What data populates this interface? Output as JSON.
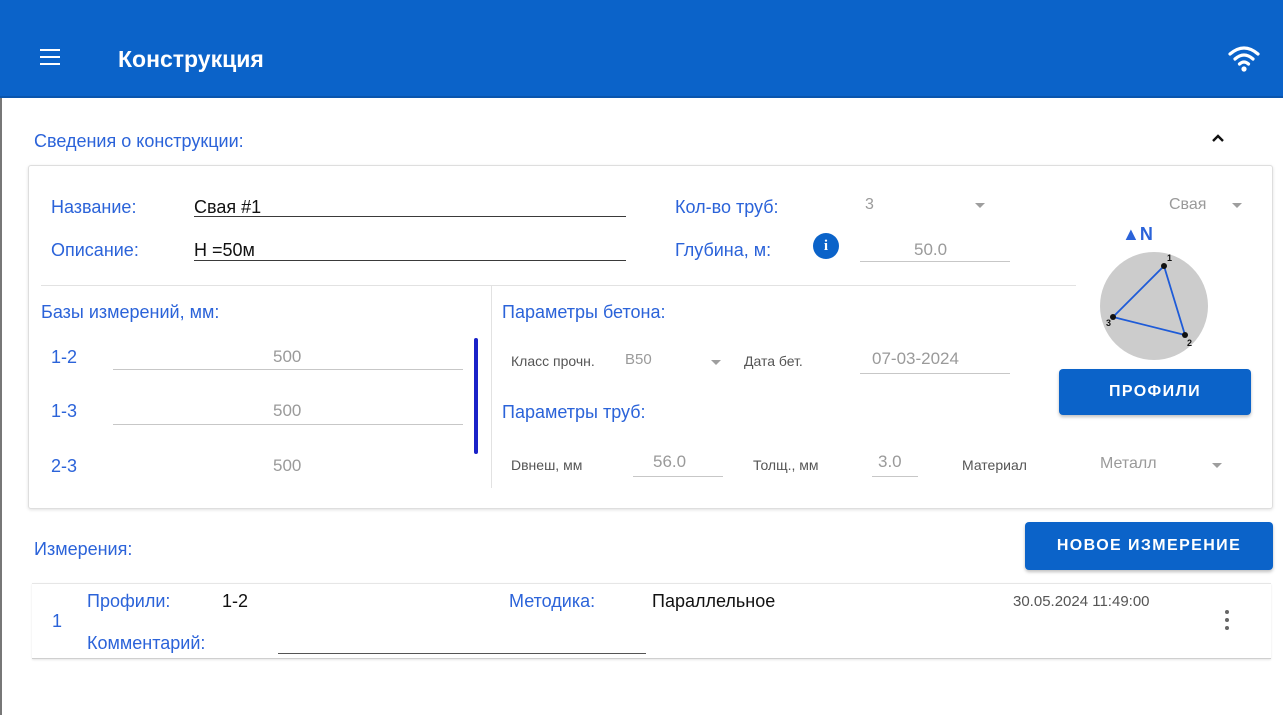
{
  "header": {
    "title": "Конструкция"
  },
  "section": {
    "title": "Сведения о конструкции:"
  },
  "construction": {
    "name_label": "Название:",
    "name_value": "Свая #1",
    "desc_label": "Описание:",
    "desc_value": "H =50м",
    "pipes_label": "Кол-во труб:",
    "pipes_value": "3",
    "depth_label": "Глубина, м:",
    "depth_value": "50.0",
    "type_value": "Свая",
    "north_label": "▲N"
  },
  "bases": {
    "title": "Базы измерений, мм:",
    "rows": [
      {
        "label": "1-2",
        "value": "500"
      },
      {
        "label": "1-3",
        "value": "500"
      },
      {
        "label": "2-3",
        "value": "500"
      }
    ]
  },
  "concrete": {
    "title": "Параметры бетона:",
    "class_label": "Класс прочн.",
    "class_value": "B50",
    "date_label": "Дата бет.",
    "date_value": "07-03-2024"
  },
  "pipes": {
    "title": "Параметры труб:",
    "dout_label": "Dвнеш, мм",
    "dout_value": "56.0",
    "thick_label": "Толщ., мм",
    "thick_value": "3.0",
    "material_label": "Материал",
    "material_value": "Металл"
  },
  "diagram": {
    "points": [
      "1",
      "2",
      "3"
    ]
  },
  "buttons": {
    "profiles": "ПРОФИЛИ",
    "new_measurement": "НОВОЕ ИЗМЕРЕНИЕ"
  },
  "measurements": {
    "title": "Измерения:",
    "items": [
      {
        "index": "1",
        "profiles_label": "Профили:",
        "profiles_value": "1-2",
        "method_label": "Методика:",
        "method_value": "Параллельное",
        "comment_label": "Комментарий:",
        "datetime": "30.05.2024 11:49:00"
      }
    ]
  },
  "colors": {
    "header": "#0b63c9",
    "accent": "#2b63d9",
    "scrollbar": "#1a22c8"
  }
}
